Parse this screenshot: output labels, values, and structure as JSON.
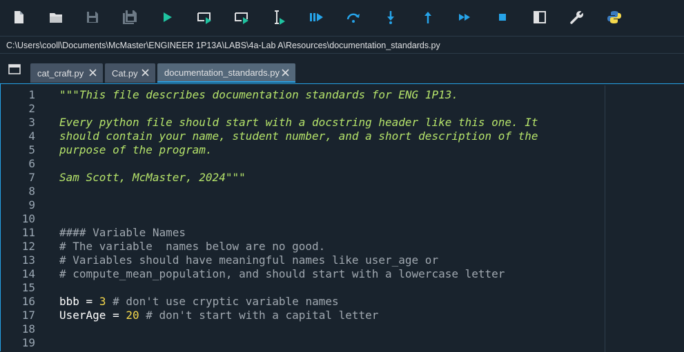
{
  "toolbar": {
    "buttons": [
      {
        "name": "new-file-icon"
      },
      {
        "name": "open-file-icon"
      },
      {
        "name": "save-icon"
      },
      {
        "name": "save-all-icon"
      },
      {
        "name": "run-icon"
      },
      {
        "name": "run-cell-icon"
      },
      {
        "name": "run-cell-advance-icon"
      },
      {
        "name": "run-selection-icon"
      },
      {
        "name": "debug-icon"
      },
      {
        "name": "step-over-icon"
      },
      {
        "name": "step-into-icon"
      },
      {
        "name": "step-out-icon"
      },
      {
        "name": "continue-icon"
      },
      {
        "name": "stop-icon"
      },
      {
        "name": "maximize-pane-icon"
      },
      {
        "name": "preferences-wrench-icon"
      },
      {
        "name": "python-path-icon"
      }
    ],
    "accent": "#26a3e8",
    "run_green": "#1fc3a0"
  },
  "path": "C:\\Users\\cooll\\Documents\\McMaster\\ENGINEER 1P13A\\LABS\\4a-Lab A\\Resources\\documentation_standards.py",
  "tabs": [
    {
      "label": "cat_craft.py"
    },
    {
      "label": "Cat.py"
    },
    {
      "label": "documentation_standards.py"
    }
  ],
  "editor": {
    "line_numbers": [
      "1",
      "2",
      "3",
      "4",
      "5",
      "6",
      "7",
      "8",
      "9",
      "10",
      "11",
      "12",
      "13",
      "14",
      "15",
      "16",
      "17",
      "18",
      "19"
    ],
    "lines": [
      {
        "doc": "\"\"\"This file describes documentation standards for ENG 1P13."
      },
      {
        "doc": ""
      },
      {
        "doc": "Every python file should start with a docstring header like this one. It"
      },
      {
        "doc": "should contain your name, student number, and a short description of the"
      },
      {
        "doc": "purpose of the program."
      },
      {
        "doc": ""
      },
      {
        "doc": "Sam Scott, McMaster, 2024\"\"\""
      },
      {
        "text": ""
      },
      {
        "text": ""
      },
      {
        "text": ""
      },
      {
        "comment": "#### Variable Names"
      },
      {
        "comment": "# The variable  names below are no good."
      },
      {
        "comment": "# Variables should have meaningful names like user_age or"
      },
      {
        "comment": "# compute_mean_population, and should start with a lowercase letter"
      },
      {
        "text": ""
      },
      {
        "name": "bbb",
        "op": " = ",
        "num": "3",
        "comment": " # don't use cryptic variable names"
      },
      {
        "name": "UserAge",
        "op": " = ",
        "num": "20",
        "comment": " # don't start with a capital letter"
      },
      {
        "text": ""
      },
      {
        "text": ""
      }
    ]
  }
}
